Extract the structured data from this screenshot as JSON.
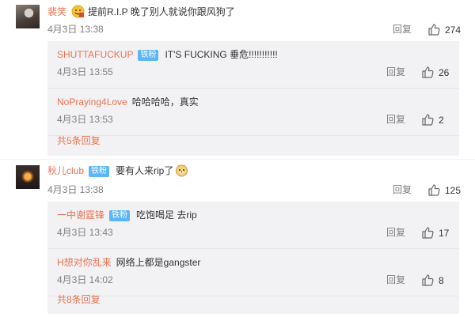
{
  "comments": [
    {
      "username": "裴笑",
      "text": "提前R.I.P 晚了别人就说你跟风狗了",
      "time": "4月3日 13:38",
      "reply_label": "回复",
      "likes": "274",
      "replies": [
        {
          "username": "SHUTTAFUCKUP",
          "badge": "铁粉",
          "text": "IT'S FUCKING 垂危!!!!!!!!!!!",
          "time": "4月3日 13:55",
          "reply_label": "回复",
          "likes": "26"
        },
        {
          "username": "NoPraying4Love",
          "text": "哈哈哈哈，真实",
          "time": "4月3日 13:53",
          "reply_label": "回复",
          "likes": "2"
        }
      ],
      "more_label": "共5条回复"
    },
    {
      "username": "秋儿club",
      "badge": "铁粉",
      "text": "要有人来rip了",
      "time": "4月3日 13:38",
      "reply_label": "回复",
      "likes": "125",
      "replies": [
        {
          "username": "一中谢霆锋",
          "badge": "铁粉",
          "text": "吃饱喝足 去rip",
          "time": "4月3日 13:43",
          "reply_label": "回复",
          "likes": "17"
        },
        {
          "username": "H想对你乱来",
          "text": "网络上都是gangster",
          "time": "4月3日 14:02",
          "reply_label": "回复",
          "likes": "8"
        }
      ],
      "more_label": "共8条回复"
    }
  ],
  "colors": {
    "username": "#eb7350",
    "meta": "#808080",
    "badge": "#5bb6f5",
    "reply_bg": "#f2f2f5"
  },
  "icons": {
    "like": "thumbs-up-icon",
    "emoji1": "grinning-emoji-icon",
    "emoji2": "doge-emoji-icon"
  }
}
